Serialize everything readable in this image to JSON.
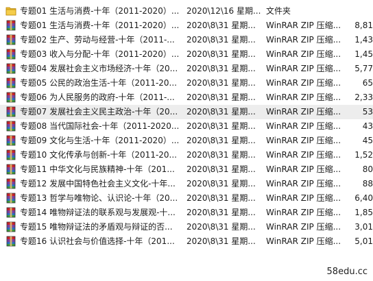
{
  "files": [
    {
      "icon": "folder-icon",
      "name": "专题01 生活与消费-十年（2011-2020）...",
      "date": "2020\\12\\16 星期...",
      "type": "文件夹",
      "size": ""
    },
    {
      "icon": "winrar-archive-icon",
      "name": "专题01 生活与消费-十年（2011-2020）...",
      "date": "2020\\8\\31 星期...",
      "type": "WinRAR ZIP 压缩...",
      "size": "8,81"
    },
    {
      "icon": "winrar-archive-icon",
      "name": "专题02 生产、劳动与经营-十年（2011-...",
      "date": "2020\\8\\31 星期...",
      "type": "WinRAR ZIP 压缩...",
      "size": "1,43"
    },
    {
      "icon": "winrar-archive-icon",
      "name": "专题03 收入与分配-十年（2011-2020）...",
      "date": "2020\\8\\31 星期...",
      "type": "WinRAR ZIP 压缩...",
      "size": "1,45"
    },
    {
      "icon": "winrar-archive-icon",
      "name": "专题04 发展社会主义市场经济-十年（20...",
      "date": "2020\\8\\31 星期...",
      "type": "WinRAR ZIP 压缩...",
      "size": "5,77"
    },
    {
      "icon": "winrar-archive-icon",
      "name": "专题05 公民的政治生活-十年（2011-20...",
      "date": "2020\\8\\31 星期...",
      "type": "WinRAR ZIP 压缩...",
      "size": "65"
    },
    {
      "icon": "winrar-archive-icon",
      "name": "专题06 为人民服务的政府-十年（2011-...",
      "date": "2020\\8\\31 星期...",
      "type": "WinRAR ZIP 压缩...",
      "size": "2,33"
    },
    {
      "icon": "winrar-archive-icon",
      "name": "专题07 发展社会主义民主政治-十年（20...",
      "date": "2020\\8\\31 星期...",
      "type": "WinRAR ZIP 压缩...",
      "size": "53"
    },
    {
      "icon": "winrar-archive-icon",
      "name": "专题08 当代国际社会-十年（2011-2020...",
      "date": "2020\\8\\31 星期...",
      "type": "WinRAR ZIP 压缩...",
      "size": "43"
    },
    {
      "icon": "winrar-archive-icon",
      "name": "专题09 文化与生活-十年（2011-2020）...",
      "date": "2020\\8\\31 星期...",
      "type": "WinRAR ZIP 压缩...",
      "size": "45"
    },
    {
      "icon": "winrar-archive-icon",
      "name": "专题10 文化传承与创新-十年（2011-20...",
      "date": "2020\\8\\31 星期...",
      "type": "WinRAR ZIP 压缩...",
      "size": "1,52"
    },
    {
      "icon": "winrar-archive-icon",
      "name": "专题11 中华文化与民族精神-十年（201...",
      "date": "2020\\8\\31 星期...",
      "type": "WinRAR ZIP 压缩...",
      "size": "80"
    },
    {
      "icon": "winrar-archive-icon",
      "name": "专题12 发展中国特色社会主义文化-十年...",
      "date": "2020\\8\\31 星期...",
      "type": "WinRAR ZIP 压缩...",
      "size": "88"
    },
    {
      "icon": "winrar-archive-icon",
      "name": "专题13 哲学与唯物论、认识论-十年（20...",
      "date": "2020\\8\\31 星期...",
      "type": "WinRAR ZIP 压缩...",
      "size": "6,40"
    },
    {
      "icon": "winrar-archive-icon",
      "name": "专题14 唯物辩证法的联系观与发展观-十...",
      "date": "2020\\8\\31 星期...",
      "type": "WinRAR ZIP 压缩...",
      "size": "1,85"
    },
    {
      "icon": "winrar-archive-icon",
      "name": "专题15 唯物辩证法的矛盾观与辩证的否...",
      "date": "2020\\8\\31 星期...",
      "type": "WinRAR ZIP 压缩...",
      "size": "3,01"
    },
    {
      "icon": "winrar-archive-icon",
      "name": "专题16 认识社会与价值选择-十年（201...",
      "date": "2020\\8\\31 星期...",
      "type": "WinRAR ZIP 压缩...",
      "size": "5,01"
    }
  ],
  "selected_row": 7,
  "watermark": "58edu.cc",
  "colors": {
    "folder": "#e8b931",
    "rar_red": "#c8232c",
    "rar_purple": "#7b3fa0",
    "rar_blue": "#2a6fc0",
    "rar_green": "#3a9a3c",
    "selected_bg": "#ededed"
  }
}
